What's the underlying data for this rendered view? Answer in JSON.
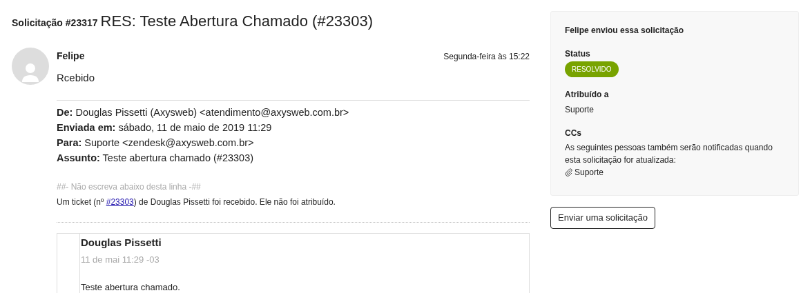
{
  "header": {
    "request_label": "Solicitação #23317",
    "subject": "RES: Teste Abertura Chamado (#23303)"
  },
  "comment": {
    "author": "Felipe",
    "time": "Segunda-feira às 15:22",
    "text": "Rcebido",
    "mail_headers": [
      "**De:** Douglas Pissetti (Axysweb) <atendimento@axysweb.com.br>",
      "**Enviada em:** sábado, 11 de maio de 2019 11:29",
      "**Para:** Suporte <zendesk@axysweb.com.br>",
      "**Assunto:** Teste abertura chamado (#23303)"
    ],
    "marker": "##- Não escreva abaixo desta linha -##",
    "notice": {
      "before": "Um ticket (nº ",
      "link": "#23303",
      "after": ") de Douglas Pissetti foi recebido. Ele não foi atribuído."
    },
    "quote": {
      "author": "Douglas Pissetti",
      "time": "11 de mai 11:29 -03",
      "text": "Teste abertura chamado."
    }
  },
  "sidebar": {
    "title": "Felipe enviou essa solicitação",
    "status_label": "Status",
    "status": {
      "label": "RESOLVIDO",
      "color": "#78a300"
    },
    "assigned_label": "Atribuído a",
    "assigned": "Suporte",
    "ccs_label": "CCs",
    "ccs_note": "As seguintes pessoas também serão notificadas quando esta solicitação for atualizada:",
    "ccs": [
      "Suporte"
    ]
  },
  "button": "Enviar uma solicitação"
}
